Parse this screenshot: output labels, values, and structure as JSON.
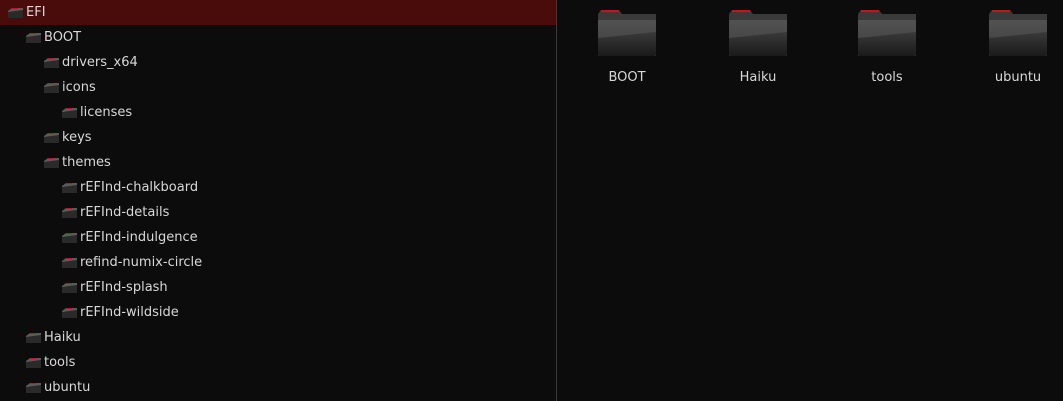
{
  "tree": {
    "items": [
      {
        "label": "EFI",
        "selected": true
      },
      {
        "label": "BOOT"
      },
      {
        "label": "drivers_x64"
      },
      {
        "label": "icons"
      },
      {
        "label": "licenses"
      },
      {
        "label": "keys"
      },
      {
        "label": "themes"
      },
      {
        "label": "rEFInd-chalkboard"
      },
      {
        "label": "rEFInd-details"
      },
      {
        "label": "rEFInd-indulgence"
      },
      {
        "label": "refind-numix-circle"
      },
      {
        "label": "rEFInd-splash"
      },
      {
        "label": "rEFInd-wildside"
      },
      {
        "label": "Haiku"
      },
      {
        "label": "tools"
      },
      {
        "label": "ubuntu"
      }
    ]
  },
  "grid": {
    "items": [
      {
        "label": "BOOT",
        "icon": "folder-icon"
      },
      {
        "label": "Haiku",
        "icon": "folder-icon"
      },
      {
        "label": "tools",
        "icon": "folder-icon"
      },
      {
        "label": "ubuntu",
        "icon": "folder-icon"
      }
    ]
  },
  "colors": {
    "background": "#0c0c0c",
    "selection": "#4a0b0b",
    "folder_accent": "#c2161b",
    "text": "#d8d8d8"
  }
}
